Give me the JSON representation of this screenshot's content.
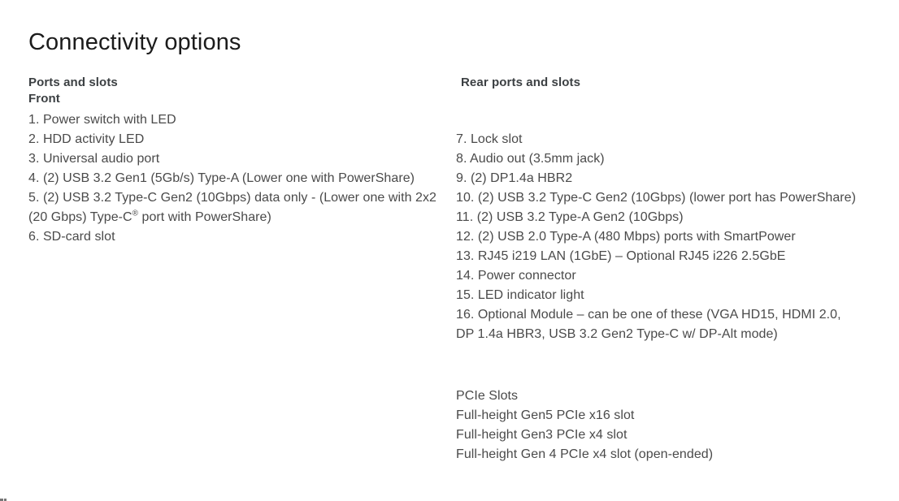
{
  "document": {
    "title": "Connectivity options"
  },
  "left_column": {
    "heading": "Ports and slots",
    "subheading": "Front",
    "items": [
      "1. Power switch with LED",
      "2. HDD activity LED",
      "3. Universal audio port",
      "4. (2) USB 3.2 Gen1 (5Gb/s) Type-A (Lower one with PowerShare)",
      "5. (2) USB 3.2 Type-C Gen2 (10Gbps) data only - (Lower one with 2x2",
      "6. SD-card slot"
    ],
    "item5_wrap_before": "(20 Gbps) Type-C",
    "item5_wrap_superscript": "®",
    "item5_wrap_after": " port with PowerShare)"
  },
  "right_column": {
    "heading": "Rear ports and slots",
    "items": [
      "7. Lock slot",
      "8. Audio out (3.5mm jack)",
      "9. (2) DP1.4a HBR2",
      "10. (2) USB 3.2 Type-C Gen2 (10Gbps) (lower port has PowerShare)",
      "11. (2) USB 3.2 Type-A Gen2 (10Gbps)",
      "12. (2) USB 2.0 Type-A (480 Mbps) ports with SmartPower",
      "13. RJ45 i219 LAN (1GbE) – Optional RJ45 i226 2.5GbE",
      "14. Power connector",
      "15. LED indicator light",
      "16. Optional Module – can be one of these (VGA HD15, HDMI 2.0,",
      "DP 1.4a HBR3, USB 3.2 Gen2 Type-C w/ DP-Alt mode)"
    ],
    "pcie": {
      "heading": "PCIe Slots",
      "slots": [
        "Full-height Gen5 PCIe x16 slot",
        "Full-height Gen3 PCIe x4 slot",
        "Full-height Gen 4 PCIe x4 slot (open-ended)"
      ]
    }
  },
  "colors": {
    "title": "#1b1b1b",
    "heading": "#3c4043",
    "body": "#4a4a4a",
    "background": "#ffffff"
  }
}
